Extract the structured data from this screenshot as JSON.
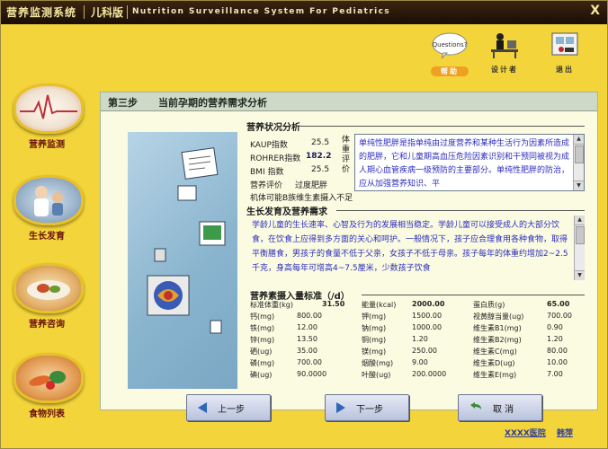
{
  "window": {
    "app_name": "营养监测系统",
    "module": "儿科版",
    "subtitle": "Nutrition Surveillance System For Pediatrics",
    "close_label": "X"
  },
  "nav": [
    {
      "label": "营养监测",
      "icon": "heartbeat-monitor-icon"
    },
    {
      "label": "生长发育",
      "icon": "doctor-child-icon"
    },
    {
      "label": "营养咨询",
      "icon": "food-plate-icon"
    },
    {
      "label": "食物列表",
      "icon": "vegetables-icon"
    }
  ],
  "tools": [
    {
      "label": "帮助",
      "bubble": "Questions?",
      "icon": "help-question-icon"
    },
    {
      "label": "设计者",
      "icon": "designer-desk-icon"
    },
    {
      "label": "退出",
      "icon": "exit-door-icon"
    }
  ],
  "step": {
    "number": "第三步",
    "title": "当前孕期的营养需求分析"
  },
  "status_section": {
    "title": "营养状况分析",
    "rows": [
      {
        "name": "KAUP指数",
        "value": "25.5"
      },
      {
        "name": "ROHRER指数",
        "value": "182.2"
      },
      {
        "name": "BMI 指数",
        "value": "25.5"
      }
    ],
    "evaluation_label": "营养评价",
    "evaluation_value": "过度肥胖",
    "warning_text": "机体可能B族维生素摄入不足",
    "vertical_label": "体重评价",
    "description": "单纯性肥胖是指单纯由过度营养和某种生活行为因素所造成的肥胖，它和儿童期高血压危险因素识别和干预同被视为成人期心血管疾病一级预防的主要部分。单纯性肥胖的防治，应从加强营养知识、平"
  },
  "growth_section": {
    "title": "生长发育及营养需求",
    "text": "学龄儿童的生长速率、心智及行为的发展相当稳定。学龄儿童可以接受成人的大部分饮食，在饮食上应得到多方面的关心和呵护。一般情况下，孩子应合理食用各种食物，取得平衡膳食，男孩子的食量不低于父亲，女孩子不低于母亲。孩子每年的体重约增加2~2.5千克，身高每年可增高4~7.5厘米，少数孩子饮食"
  },
  "standard_section": {
    "title": "营养素摄入量标准（/d）",
    "header": [
      {
        "name": "标准体重(kg)",
        "value": "31.50"
      },
      {
        "name": "能量(kcal)",
        "value": "2000.00"
      },
      {
        "name": "蛋白质(g)",
        "value": "65.00"
      }
    ],
    "rows": [
      [
        {
          "name": "钙(mg)",
          "value": "800.00"
        },
        {
          "name": "钾(mg)",
          "value": "1500.00"
        },
        {
          "name": "视黄醇当量(ug)",
          "value": "700.00"
        }
      ],
      [
        {
          "name": "铁(mg)",
          "value": "12.00"
        },
        {
          "name": "钠(mg)",
          "value": "1000.00"
        },
        {
          "name": "维生素B1(mg)",
          "value": "0.90"
        }
      ],
      [
        {
          "name": "锌(mg)",
          "value": "13.50"
        },
        {
          "name": "铜(mg)",
          "value": "1.20"
        },
        {
          "name": "维生素B2(mg)",
          "value": "1.20"
        }
      ],
      [
        {
          "name": "硒(ug)",
          "value": "35.00"
        },
        {
          "name": "镁(mg)",
          "value": "250.00"
        },
        {
          "name": "维生素C(mg)",
          "value": "80.00"
        }
      ],
      [
        {
          "name": "磷(mg)",
          "value": "700.00"
        },
        {
          "name": "烟酸(mg)",
          "value": "9.00"
        },
        {
          "name": "维生素D(ug)",
          "value": "10.00"
        }
      ],
      [
        {
          "name": "碘(ug)",
          "value": "90.0000"
        },
        {
          "name": "叶酸(ug)",
          "value": "200.0000"
        },
        {
          "name": "维生素E(mg)",
          "value": "7.00"
        }
      ]
    ]
  },
  "buttons": {
    "prev": "上一步",
    "next": "下一步",
    "cancel": "取 消"
  },
  "footer": {
    "org": "XXXX医院",
    "author": "韩萍"
  },
  "colors": {
    "background": "#f3d43a",
    "panel": "#fafbe0",
    "step_bar": "#cfd9c8",
    "description_text": "#2d2dbd",
    "footer_link": "#2d3da0"
  }
}
